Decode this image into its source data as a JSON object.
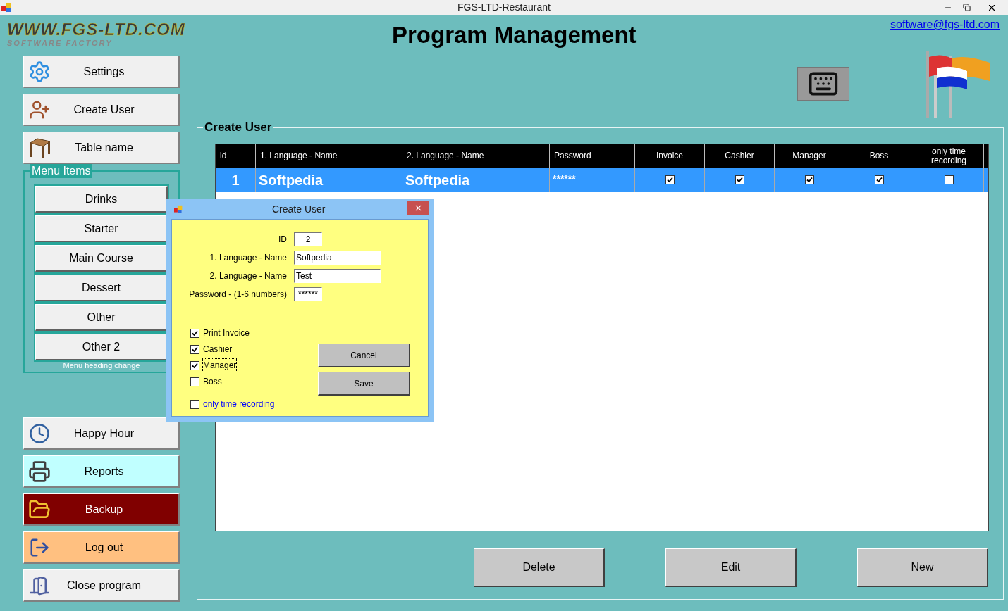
{
  "window": {
    "title": "FGS-LTD-Restaurant"
  },
  "logo": {
    "line1": "WWW.FGS-LTD.COM",
    "line2": "SOFTWARE FACTORY"
  },
  "header": {
    "title": "Program Management",
    "email": "software@fgs-ltd.com"
  },
  "sidebar_top": [
    {
      "label": "Settings",
      "kind": "settings"
    },
    {
      "label": "Create User",
      "kind": "user"
    },
    {
      "label": "Table name",
      "kind": "table"
    }
  ],
  "menu_items": {
    "title": "Menu Items",
    "items": [
      "Drinks",
      "Starter",
      "Main Course",
      "Dessert",
      "Other",
      "Other 2"
    ],
    "footer": "Menu heading change"
  },
  "sidebar_bottom": [
    {
      "label": "Happy Hour",
      "kind": "clock",
      "color": "#f0f0f0"
    },
    {
      "label": "Reports",
      "kind": "printer",
      "color": "#c0ffff"
    },
    {
      "label": "Backup",
      "kind": "folder",
      "color": "#800000"
    },
    {
      "label": "Log out",
      "kind": "logout",
      "color": "#ffc080"
    },
    {
      "label": "Close program",
      "kind": "door",
      "color": "#f0f0f0"
    }
  ],
  "group": {
    "title": "Create User"
  },
  "table": {
    "columns": [
      "id",
      "1. Language - Name",
      "2. Language - Name",
      "Password",
      "Invoice",
      "Cashier",
      "Manager",
      "Boss",
      "only time recording"
    ],
    "rows": [
      {
        "id": "1",
        "name1": "Softpedia",
        "name2": "Softpedia",
        "password": "******",
        "invoice": true,
        "cashier": true,
        "manager": true,
        "boss": true,
        "only_time": false,
        "selected": true
      }
    ]
  },
  "actions": [
    "Delete",
    "Edit",
    "New"
  ],
  "dialog": {
    "title": "Create User",
    "fields": [
      {
        "label": "ID",
        "value": "2",
        "kind": "short"
      },
      {
        "label": "1. Language - Name",
        "value": "Softpedia",
        "kind": "long"
      },
      {
        "label": "2. Language - Name",
        "value": "Test",
        "kind": "long"
      },
      {
        "label": "Password - (1-6 numbers)",
        "value": "******",
        "kind": "short"
      }
    ],
    "checkboxes": [
      {
        "label": "Print Invoice",
        "checked": true,
        "focused": false,
        "kind": "plain"
      },
      {
        "label": "Cashier",
        "checked": true,
        "focused": false,
        "kind": "plain"
      },
      {
        "label": "Manager",
        "checked": true,
        "focused": true,
        "kind": "plain"
      },
      {
        "label": "Boss",
        "checked": false,
        "focused": false,
        "kind": "plain"
      },
      {
        "label": "only time recording",
        "checked": false,
        "focused": false,
        "kind": "blue"
      }
    ],
    "buttons": [
      "Cancel",
      "Save"
    ]
  }
}
